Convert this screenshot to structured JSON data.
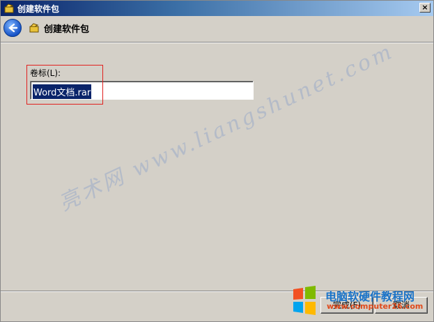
{
  "window": {
    "title": "创建软件包",
    "close_label": "×"
  },
  "header": {
    "title": "创建软件包"
  },
  "form": {
    "volume_label": "卷标(L):",
    "volume_value": "Word文档.rar"
  },
  "buttons": {
    "finish": "完成(F)",
    "cancel": "取消"
  },
  "watermark": {
    "text": "亮术网 www.liangshunet.com"
  },
  "overlay": {
    "site_name": "电脑软硬件教程网",
    "site_url": "www.computer26.com"
  },
  "colors": {
    "titlebar_start": "#0a246a",
    "selection": "#0a246a",
    "highlight_box": "#e0201e"
  }
}
